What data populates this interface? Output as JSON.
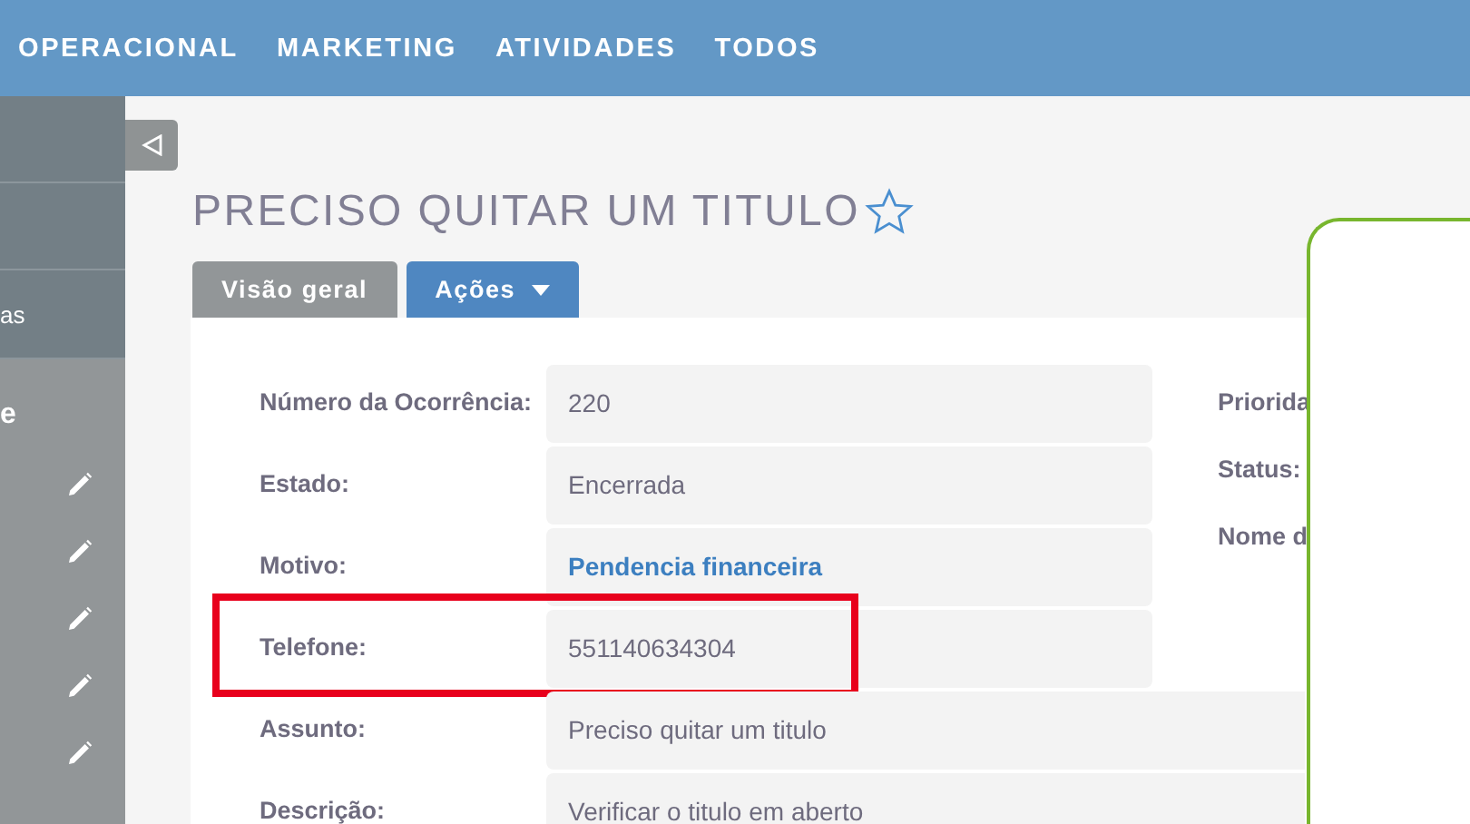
{
  "nav": {
    "items": [
      "OPERACIONAL",
      "MARKETING",
      "ATIVIDADES",
      "TODOS"
    ]
  },
  "sidebar": {
    "items": [
      {
        "label": "as"
      }
    ],
    "section_label": "e"
  },
  "title": "PRECISO QUITAR UM TITULO",
  "tabs": [
    {
      "label": "Visão geral",
      "kind": "tab"
    },
    {
      "label": "Ações",
      "kind": "dropdown"
    }
  ],
  "fields": [
    {
      "label": "Número da Ocorrência:",
      "value": "220",
      "kind": "text",
      "highlighted": false
    },
    {
      "label": "Estado:",
      "value": "Encerrada",
      "kind": "text",
      "highlighted": false
    },
    {
      "label": "Motivo:",
      "value": "Pendencia financeira",
      "kind": "link",
      "highlighted": false
    },
    {
      "label": "Telefone:",
      "value": "551140634304",
      "kind": "text",
      "highlighted": true
    }
  ],
  "right_fields": [
    "Priorida",
    "Status:",
    "Nome d"
  ],
  "wide_fields": [
    {
      "label": "Assunto:",
      "value": "Preciso quitar um titulo"
    },
    {
      "label": "Descrição:",
      "value": "Verificar o titulo em aberto"
    }
  ]
}
